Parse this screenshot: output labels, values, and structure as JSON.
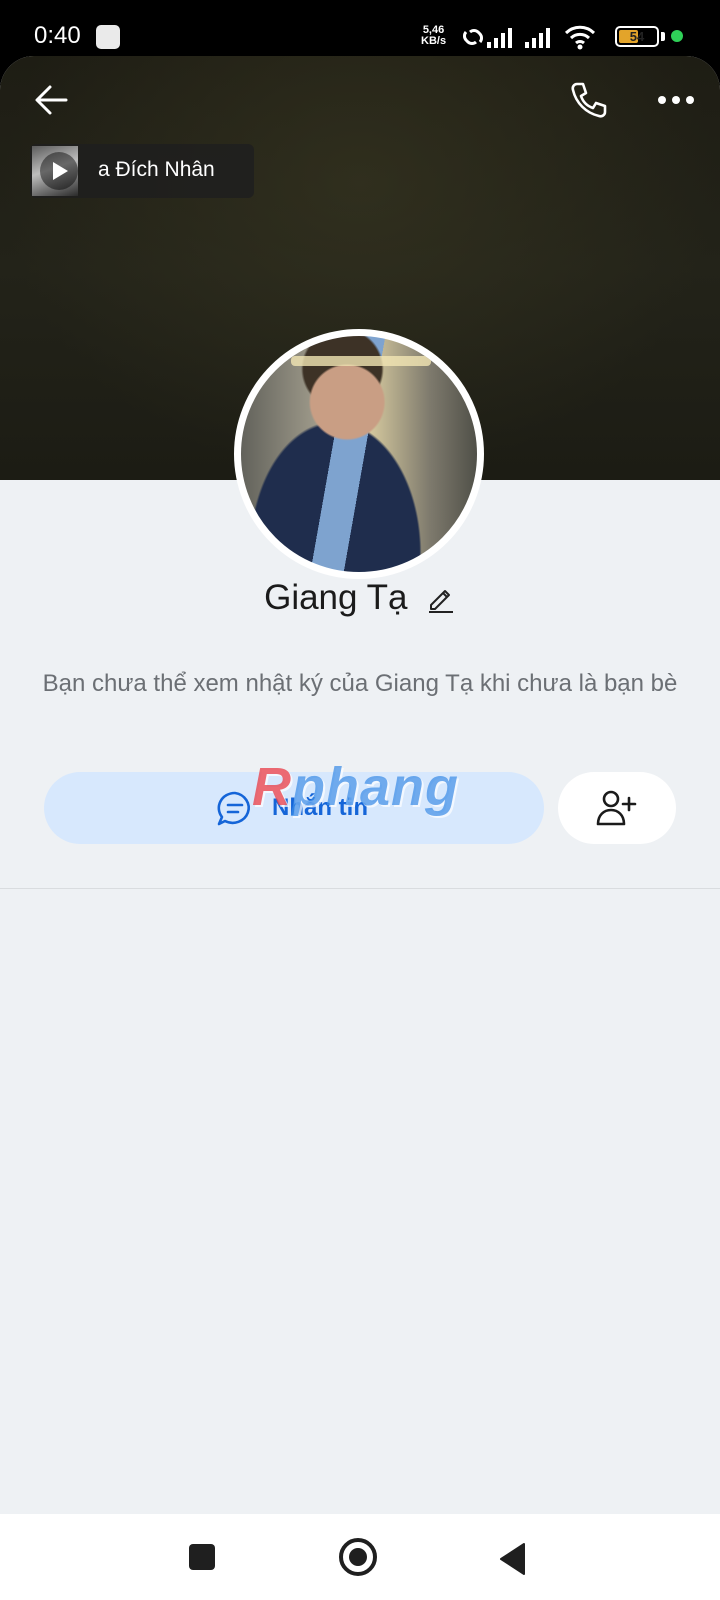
{
  "status_bar": {
    "time": "0:40",
    "net_speed_value": "5,46",
    "net_speed_unit": "KB/s",
    "battery_level": "54"
  },
  "header": {
    "back_icon": "arrow-left-icon",
    "call_icon": "phone-icon",
    "more_icon": "more-horizontal-icon"
  },
  "music": {
    "title": "a Đích Nhân"
  },
  "profile": {
    "name": "Giang Tạ",
    "privacy_note": "Bạn chưa thể xem nhật ký của Giang Tạ khi chưa là bạn bè"
  },
  "actions": {
    "message_label": "Nhắn tin",
    "add_friend_icon": "add-friend-icon"
  },
  "watermark": {
    "first_letter": "R",
    "rest": "phang"
  },
  "colors": {
    "accent": "#1565d8",
    "message_button_bg": "#d7e8fd",
    "page_bg": "#eef1f4"
  }
}
